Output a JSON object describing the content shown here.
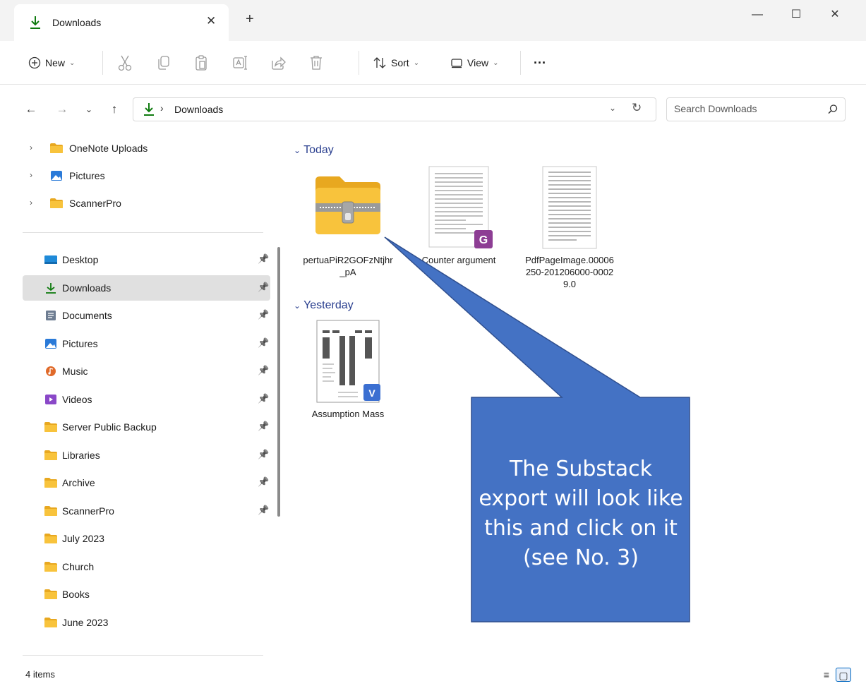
{
  "tab": {
    "title": "Downloads",
    "close": "✕",
    "add": "+"
  },
  "window_controls": {
    "minimize": "—",
    "maximize": "☐",
    "close": "✕"
  },
  "toolbar": {
    "new_label": "New",
    "sort_label": "Sort",
    "view_label": "View",
    "more_label": "···",
    "icons": [
      "cut-icon",
      "copy-icon",
      "paste-icon",
      "rename-icon",
      "share-icon",
      "delete-icon"
    ]
  },
  "address": {
    "path": "Downloads",
    "separator": "›"
  },
  "search": {
    "placeholder": "Search Downloads"
  },
  "sidebar": {
    "top_items": [
      {
        "label": "OneNote Uploads",
        "icon": "folder-icon"
      },
      {
        "label": "Pictures",
        "icon": "pictures-icon"
      },
      {
        "label": "ScannerPro",
        "icon": "folder-icon"
      }
    ],
    "quick_access": [
      {
        "label": "Desktop",
        "icon": "desktop-icon",
        "pinned": true
      },
      {
        "label": "Downloads",
        "icon": "download-icon",
        "pinned": true,
        "selected": true
      },
      {
        "label": "Documents",
        "icon": "documents-icon",
        "pinned": true
      },
      {
        "label": "Pictures",
        "icon": "pictures-icon",
        "pinned": true
      },
      {
        "label": "Music",
        "icon": "music-icon",
        "pinned": true
      },
      {
        "label": "Videos",
        "icon": "videos-icon",
        "pinned": true
      },
      {
        "label": "Server Public Backup",
        "icon": "folder-icon",
        "pinned": true
      },
      {
        "label": "Libraries",
        "icon": "folder-icon",
        "pinned": true
      },
      {
        "label": "Archive",
        "icon": "folder-icon",
        "pinned": true
      },
      {
        "label": "ScannerPro",
        "icon": "folder-icon",
        "pinned": true
      },
      {
        "label": "July 2023",
        "icon": "folder-icon",
        "pinned": false
      },
      {
        "label": "Church",
        "icon": "folder-icon",
        "pinned": false
      },
      {
        "label": "Books",
        "icon": "folder-icon",
        "pinned": false
      },
      {
        "label": "June 2023",
        "icon": "folder-icon",
        "pinned": false
      }
    ]
  },
  "content": {
    "groups": [
      {
        "label": "Today",
        "files": [
          {
            "name": "pertuaPiR2GOFzNtjhr_pA",
            "icon": "zip-folder-icon"
          },
          {
            "name": "Counter argument",
            "icon": "pdf-document-icon"
          },
          {
            "name": "PdfPageImage.00006250-201206000-00029.0",
            "icon": "document-image-icon"
          }
        ]
      },
      {
        "label": "Yesterday",
        "files": [
          {
            "name": "Assumption Mass",
            "icon": "visio-document-icon"
          }
        ]
      }
    ]
  },
  "status": {
    "count": "4 items"
  },
  "callout": {
    "text": "The Substack export will look like this and click on it (see No.  3)",
    "fill": "#4472c4",
    "stroke": "#2f4f8f"
  },
  "colors": {
    "accent": "#0f7b0f",
    "folder": "#f8c33c",
    "link_blue": "#2a3f8f"
  }
}
